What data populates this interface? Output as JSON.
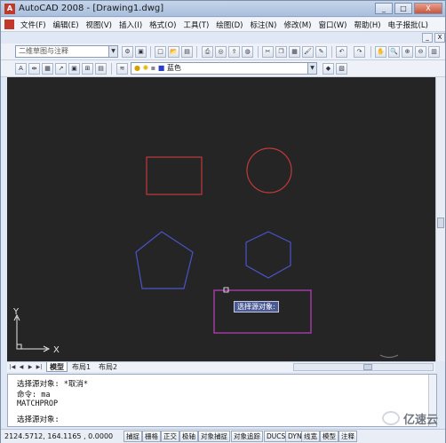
{
  "window": {
    "title": "AutoCAD 2008 - [Drawing1.dwg]",
    "controls": [
      "_",
      "□",
      "X"
    ]
  },
  "menu": {
    "items": [
      "文件(F)",
      "编辑(E)",
      "视图(V)",
      "插入(I)",
      "格式(O)",
      "工具(T)",
      "绘图(D)",
      "标注(N)",
      "修改(M)",
      "窗口(W)",
      "帮助(H)",
      "电子报批(L)"
    ],
    "doc_controls": [
      "_",
      "□",
      "X"
    ]
  },
  "toolbar": {
    "workspace_combo": "二维草图与注释",
    "color_combo": "蓝色",
    "layer_icons": [
      "bulb-icon",
      "sun-icon",
      "lock-icon",
      "color-square-icon"
    ]
  },
  "colors": {
    "canvas_bg": "#252525",
    "rectangle": "#c0393b",
    "circle": "#c0393b",
    "pentagon": "#4a53c9",
    "hexagon": "#4a53c9",
    "selection_box": "#a23aa5",
    "tooltip_bg": "#4a5a95"
  },
  "canvas": {
    "ucs_y_label": "Y",
    "ucs_x_label": "X",
    "tooltip": "选择源对象:"
  },
  "tabs": {
    "items": [
      "模型",
      "布局1",
      "布局2"
    ],
    "active": "模型"
  },
  "command": {
    "lines": [
      "选择源对象: *取消*",
      "命令: ma",
      "MATCHPROP",
      "选择源对象:"
    ]
  },
  "status": {
    "coords": "2124.5712, 164.1165 , 0.0000",
    "buttons": [
      "捕捉",
      "栅格",
      "正交",
      "极轴",
      "对象捕捉",
      "对象追踪",
      "DUCS",
      "DYN",
      "线宽",
      "模型",
      "注释"
    ]
  },
  "watermark": {
    "text": "亿速云"
  }
}
